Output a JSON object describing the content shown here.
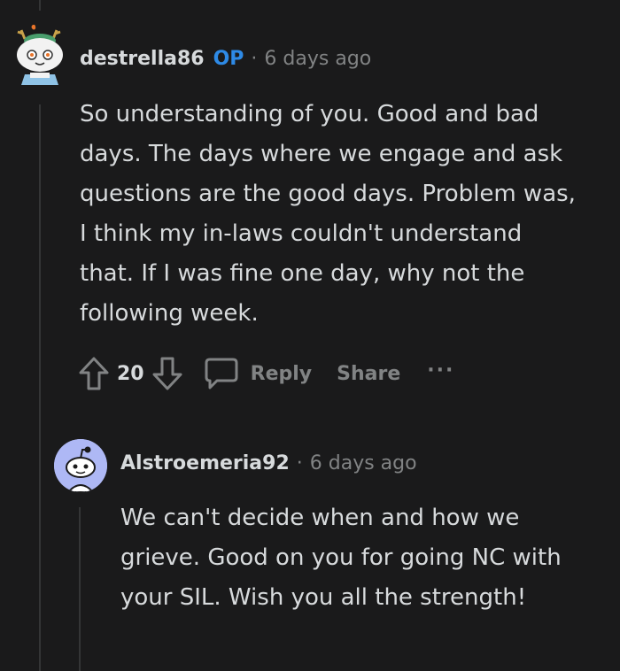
{
  "comments": [
    {
      "username": "destrella86",
      "op_badge": "OP",
      "separator": "·",
      "time": "6 days ago",
      "body": "So understanding of you. Good and bad days. The days where we engage and ask questions are the good days. Problem was, I think my in-laws couldn't understand that. If I was fine one day, why not the following week.",
      "score": "20",
      "reply_label": "Reply",
      "share_label": "Share",
      "more_label": "···"
    },
    {
      "username": "Alstroemeria92",
      "separator": "·",
      "time": "6 days ago",
      "body": "We can't decide when and how we grieve. Good on you for going NC with your SIL. Wish you all the strength!"
    }
  ]
}
